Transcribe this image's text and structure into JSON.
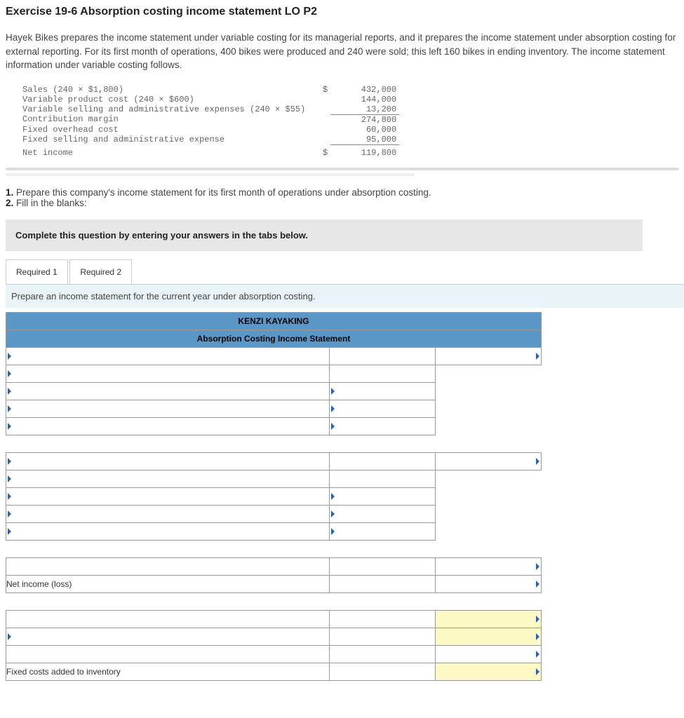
{
  "title": "Exercise 19-6 Absorption costing income statement LO P2",
  "intro": "Hayek Bikes prepares the income statement under variable costing for its managerial reports, and it prepares the income statement under absorption costing for external reporting. For its first month of operations, 400 bikes were produced and 240 were sold; this left 160 bikes in ending inventory. The income statement information under variable costing follows.",
  "variable_stmt": {
    "rows": [
      {
        "label": "Sales (240 × $1,800)",
        "pre": "$",
        "amt": "432,000",
        "ul": false
      },
      {
        "label": "Variable product cost (240 × $600)",
        "pre": "",
        "amt": "144,000",
        "ul": false
      },
      {
        "label": "Variable selling and administrative expenses (240 × $55)",
        "pre": "",
        "amt": "13,200",
        "ul": true
      },
      {
        "label": "Contribution margin",
        "pre": "",
        "amt": "274,800",
        "ul": false
      },
      {
        "label": "Fixed overhead cost",
        "pre": "",
        "amt": "60,000",
        "ul": false
      },
      {
        "label": "Fixed selling and administrative expense",
        "pre": "",
        "amt": "95,000",
        "ul": true
      },
      {
        "label": "Net income",
        "pre": "$",
        "amt": "119,800",
        "ul": false
      }
    ]
  },
  "questions": {
    "q1": "Prepare this company's income statement for its first month of operations under absorption costing.",
    "q2": "Fill in the blanks:"
  },
  "cq_instruction": "Complete this question by entering your answers in the tabs below.",
  "tabs": {
    "t1": "Required 1",
    "t2": "Required 2"
  },
  "sub_instruction": "Prepare an income statement for the current year under absorption costing.",
  "answer_table": {
    "company": "KENZI KAYAKING",
    "statement_title": "Absorption Costing Income Statement",
    "net_income_label": "Net income (loss)",
    "fixed_costs_label": "Fixed costs added to inventory"
  }
}
